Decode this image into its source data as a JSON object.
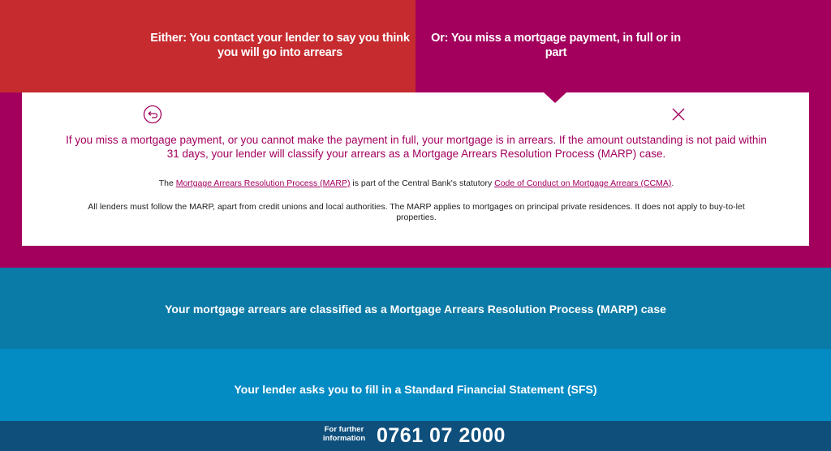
{
  "top": {
    "either_text": "Either: You contact your lender to say you think you will go into arrears",
    "or_text": "Or: You miss a mortgage payment, in full or in part"
  },
  "card": {
    "back_icon": "back-arrow-circle-icon",
    "close_icon": "close-x-icon",
    "lead": "If you miss a mortgage payment, or you cannot make the payment in full, your mortgage is in arrears. If the amount outstanding is not paid within 31 days, your lender will classify your arrears as a Mortgage Arrears Resolution Process (MARP) case.",
    "p1_prefix": "The ",
    "p1_link1": "Mortgage Arrears Resolution Process (MARP)",
    "p1_middle": " is part of the Central Bank's statutory ",
    "p1_link2": "Code of Conduct on Mortgage Arrears (CCMA)",
    "p1_suffix": ".",
    "p2": "All lenders must follow the MARP, apart from credit unions and local authorities. The MARP applies to mortgages on principal private residences. It does not apply to buy-to-let properties."
  },
  "steps": {
    "classified": "Your mortgage arrears are classified as a Mortgage Arrears Resolution Process (MARP) case",
    "sfs": "Your lender asks you to fill in a Standard Financial Statement (SFS)"
  },
  "footer": {
    "further_label": "For further information",
    "phone": "0761 07 2000"
  },
  "colors": {
    "red": "#c62b2f",
    "magenta": "#a3005e",
    "teal": "#0a7aa6",
    "blue": "#038bc4",
    "navy": "#0e4f7c"
  }
}
